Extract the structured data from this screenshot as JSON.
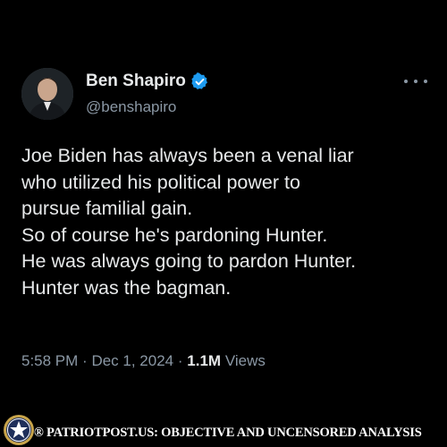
{
  "tweet": {
    "author": {
      "display_name": "Ben Shapiro",
      "handle": "@benshapiro",
      "verified": true,
      "verified_color": "#1d9bf0"
    },
    "more_icon": "ellipsis-icon",
    "body_lines": [
      "Joe Biden has always been a venal liar",
      "who utilized his political power to",
      "pursue familial gain.",
      "So of course he's pardoning Hunter.",
      "He was always going to pardon Hunter.",
      "Hunter was the bagman."
    ],
    "time": "5:58 PM",
    "separator": "·",
    "date": "Dec 1, 2024",
    "views_count": "1.1M",
    "views_label": "Views"
  },
  "footer": {
    "text": "® PATRIOTPOST.US: OBJECTIVE AND UNCENSORED ANALYSIS",
    "badge_icon": "star-seal-icon"
  },
  "colors": {
    "background": "#000000",
    "text_primary": "#e7e9ea",
    "text_secondary": "#8b98a5"
  }
}
